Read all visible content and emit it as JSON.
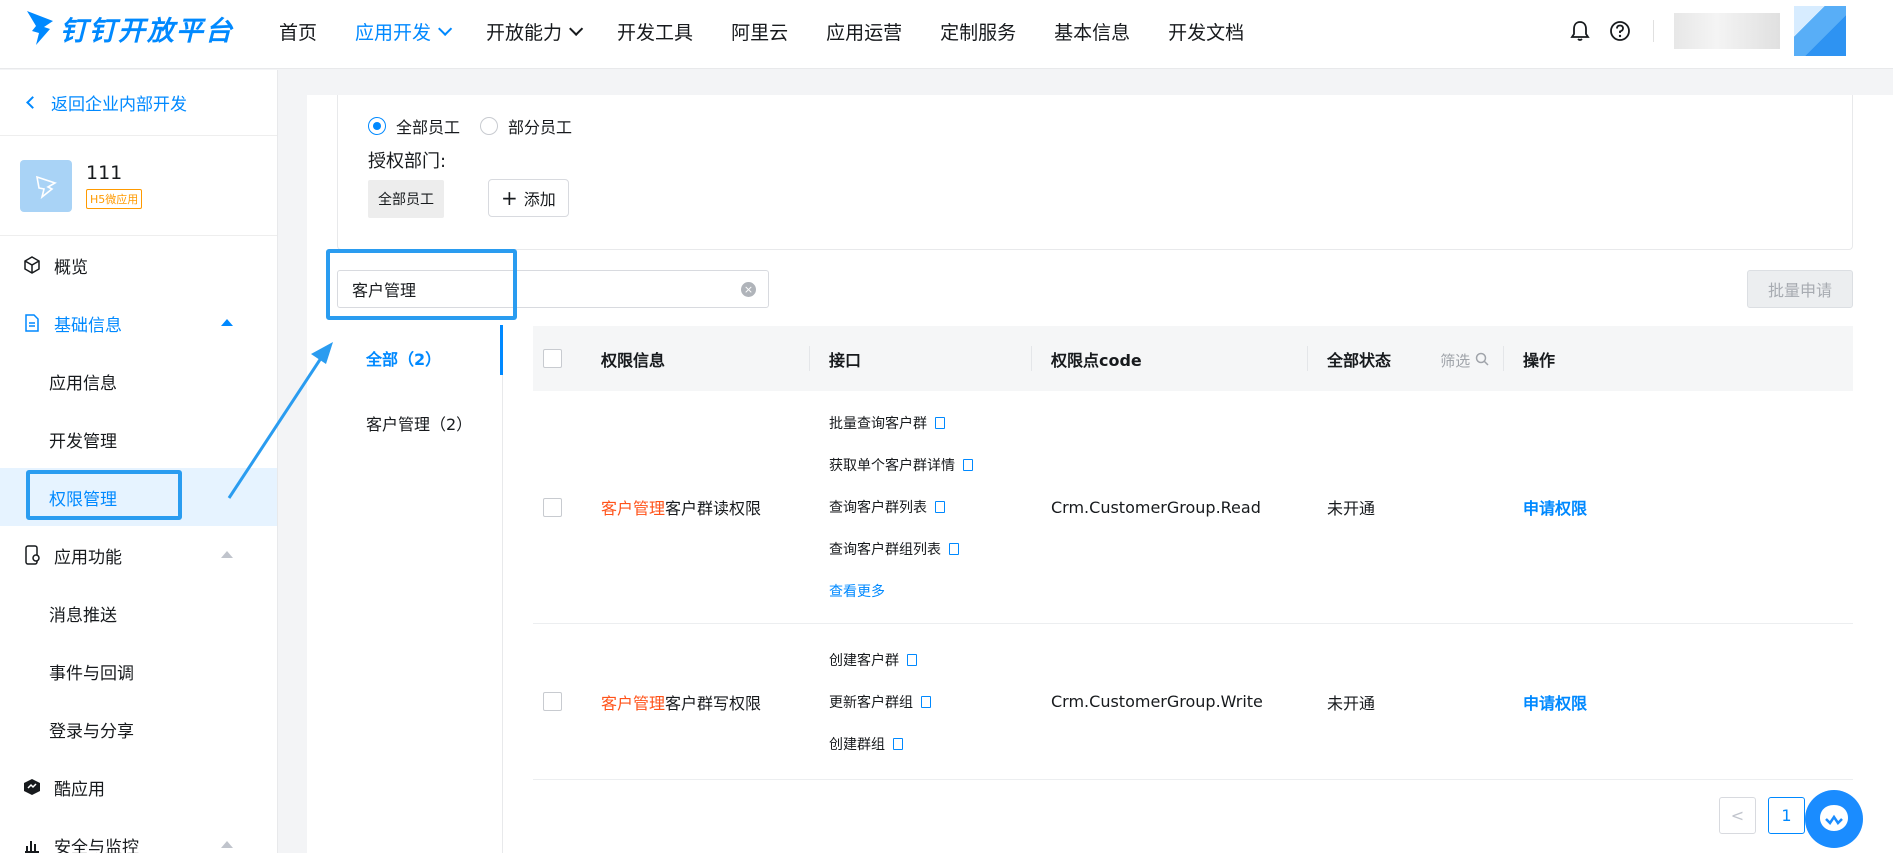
{
  "brand": {
    "name": "钉钉开放平台",
    "color": "#0089ff"
  },
  "nav": {
    "items": [
      {
        "label": "首页",
        "active": false,
        "dropdown": false
      },
      {
        "label": "应用开发",
        "active": true,
        "dropdown": true
      },
      {
        "label": "开放能力",
        "active": false,
        "dropdown": true
      },
      {
        "label": "开发工具",
        "active": false,
        "dropdown": false
      },
      {
        "label": "阿里云",
        "active": false,
        "dropdown": false
      },
      {
        "label": "应用运营",
        "active": false,
        "dropdown": false
      },
      {
        "label": "定制服务",
        "active": false,
        "dropdown": false
      },
      {
        "label": "基本信息",
        "active": false,
        "dropdown": false
      },
      {
        "label": "开发文档",
        "active": false,
        "dropdown": false
      }
    ]
  },
  "sidebar": {
    "back_label": "返回企业内部开发",
    "app_name": "111",
    "app_badge": "H5微应用",
    "menu": {
      "overview": "概览",
      "basic_info": "基础信息",
      "app_info": "应用信息",
      "dev_manage": "开发管理",
      "permission_manage": "权限管理",
      "app_features": "应用功能",
      "message_push": "消息推送",
      "events_callback": "事件与回调",
      "login_share": "登录与分享",
      "cool_app": "酷应用",
      "security_monitor": "安全与监控"
    }
  },
  "auth": {
    "radio_all": "全部员工",
    "radio_partial": "部分员工",
    "dept_label": "授权部门:",
    "dept_chip": "全部员工",
    "add_label": "添加"
  },
  "search": {
    "value": "客户管理",
    "clear_icon": "×"
  },
  "batch_apply": "批量申请",
  "categories": [
    {
      "label": "全部（2）",
      "active": true
    },
    {
      "label": "客户管理（2）",
      "active": false
    }
  ],
  "table": {
    "headers": {
      "info": "权限信息",
      "api": "接口",
      "code": "权限点code",
      "status": "全部状态",
      "filter": "筛选",
      "action": "操作"
    },
    "rows": [
      {
        "info_highlight": "客户管理",
        "info_rest": "客户群读权限",
        "apis": [
          "批量查询客户群",
          "获取单个客户群详情",
          "查询客户群列表",
          "查询客户群组列表"
        ],
        "more": "查看更多",
        "code": "Crm.CustomerGroup.Read",
        "status": "未开通",
        "action": "申请权限"
      },
      {
        "info_highlight": "客户管理",
        "info_rest": "客户群写权限",
        "apis": [
          "创建客户群",
          "更新客户群组",
          "创建群组"
        ],
        "more": "",
        "code": "Crm.CustomerGroup.Write",
        "status": "未开通",
        "action": "申请权限"
      }
    ]
  },
  "pager": {
    "prev": "<",
    "current": "1"
  }
}
